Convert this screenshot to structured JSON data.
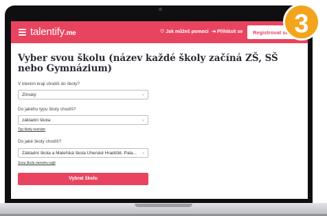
{
  "app": {
    "logo": "≡ talentify.me",
    "nav": {
      "help": "Jak můžeš pomoci",
      "login": "Přihlásit se",
      "register": "Registrovat se"
    }
  },
  "form": {
    "heading": "Vyber svou školu (název každé školy začíná ZŠ, SŠ nebo Gymnázium)",
    "q_region": "V kterém kraji chodíš do školy?",
    "region_value": "Zlínský",
    "q_type": "Do jakého typu školy chodíš?",
    "type_value": "základní škola",
    "type_not_found": "Typ školy neznám",
    "q_school": "Do jaké školy chodíš?",
    "school_value": "Základní škola a Mateřská škola Uherské Hradiště, Pala...",
    "school_not_found": "Svou školu nemohu najít",
    "submit": "Vybrat školu"
  },
  "step_number": "3"
}
